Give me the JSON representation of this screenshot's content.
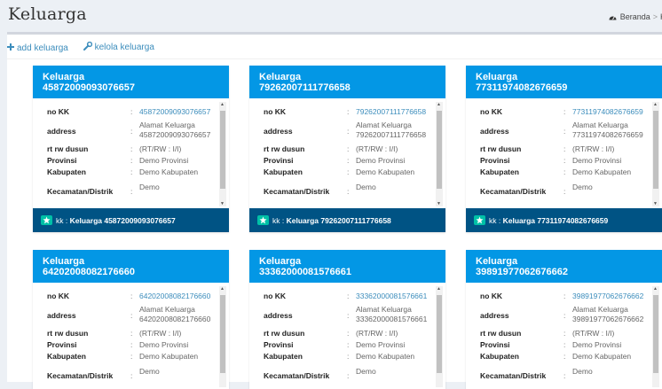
{
  "page": {
    "title": "Keluarga",
    "breadcrumb": {
      "home": "Beranda",
      "current": "K"
    }
  },
  "actions": {
    "add": "add keluarga",
    "manage": "kelola keluarga"
  },
  "labels": {
    "no_kk": "no KK",
    "address": "address",
    "rt_rw": "rt rw dusun",
    "provinsi": "Provinsi",
    "kabupaten": "Kabupaten",
    "kecamatan": "Kecamatan/Distrik",
    "colon": ":"
  },
  "cards": [
    {
      "title": "Keluarga",
      "id": "45872009093076657",
      "address1": "Alamat Keluarga",
      "address2": "45872009093076657",
      "rt_rw": "(RT/RW : I/I)",
      "provinsi": "Demo Provinsi",
      "kabupaten": "Demo Kabupaten",
      "kecamatan": "Demo",
      "footer_prefix": "kk : ",
      "footer_title": "Keluarga 45872009093076657"
    },
    {
      "title": "Keluarga",
      "id": "79262007111776658",
      "address1": "Alamat Keluarga",
      "address2": "79262007111776658",
      "rt_rw": "(RT/RW : I/I)",
      "provinsi": "Demo Provinsi",
      "kabupaten": "Demo Kabupaten",
      "kecamatan": "Demo",
      "footer_prefix": "kk : ",
      "footer_title": "Keluarga 79262007111776658"
    },
    {
      "title": "Keluarga",
      "id": "77311974082676659",
      "address1": "Alamat Keluarga",
      "address2": "77311974082676659",
      "rt_rw": "(RT/RW : I/I)",
      "provinsi": "Demo Provinsi",
      "kabupaten": "Demo Kabupaten",
      "kecamatan": "Demo",
      "footer_prefix": "kk : ",
      "footer_title": "Keluarga 77311974082676659"
    },
    {
      "title": "Keluarga",
      "id": "64202008082176660",
      "address1": "Alamat Keluarga",
      "address2": "64202008082176660",
      "rt_rw": "(RT/RW : I/I)",
      "provinsi": "Demo Provinsi",
      "kabupaten": "Demo Kabupaten",
      "kecamatan": "Demo",
      "footer_prefix": "",
      "footer_title": ""
    },
    {
      "title": "Keluarga",
      "id": "33362000081576661",
      "address1": "Alamat Keluarga",
      "address2": "33362000081576661",
      "rt_rw": "(RT/RW : I/I)",
      "provinsi": "Demo Provinsi",
      "kabupaten": "Demo Kabupaten",
      "kecamatan": "Demo",
      "footer_prefix": "",
      "footer_title": ""
    },
    {
      "title": "Keluarga",
      "id": "39891977062676662",
      "address1": "Alamat Keluarga",
      "address2": "39891977062676662",
      "rt_rw": "(RT/RW : I/I)",
      "provinsi": "Demo Provinsi",
      "kabupaten": "Demo Kabupaten",
      "kecamatan": "Demo",
      "footer_prefix": "",
      "footer_title": ""
    }
  ],
  "colors": {
    "card_header": "#0397e5",
    "card_footer": "#005384",
    "link": "#3c8dbc",
    "star_badge": "#00c0a7"
  }
}
